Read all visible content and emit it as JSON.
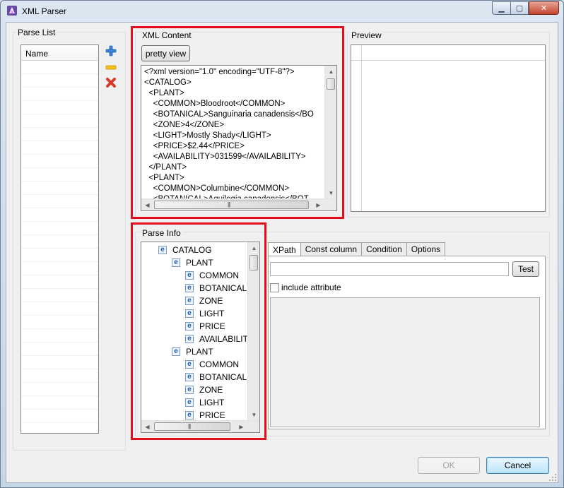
{
  "window": {
    "title": "XML Parser"
  },
  "parse_list": {
    "group_label": "Parse List",
    "column_header": "Name",
    "add_icon": "plus-icon",
    "edit_icon": "minus-icon",
    "delete_icon": "delete-x-icon"
  },
  "xml_content": {
    "group_label": "XML Content",
    "pretty_view_label": "pretty view",
    "lines": [
      "<?xml version=\"1.0\" encoding=\"UTF-8\"?>",
      "<CATALOG>",
      "  <PLANT>",
      "    <COMMON>Bloodroot</COMMON>",
      "    <BOTANICAL>Sanguinaria canadensis</BO",
      "    <ZONE>4</ZONE>",
      "    <LIGHT>Mostly Shady</LIGHT>",
      "    <PRICE>$2.44</PRICE>",
      "    <AVAILABILITY>031599</AVAILABILITY>",
      "  </PLANT>",
      "  <PLANT>",
      "    <COMMON>Columbine</COMMON>",
      "    <BOTANICAL>Aquilegia canadensis</BOT"
    ]
  },
  "preview": {
    "group_label": "Preview"
  },
  "parse_info": {
    "group_label": "Parse Info",
    "tree": [
      {
        "label": "CATALOG",
        "level": 0
      },
      {
        "label": "PLANT",
        "level": 1
      },
      {
        "label": "COMMON",
        "level": 2
      },
      {
        "label": "BOTANICAL",
        "level": 2
      },
      {
        "label": "ZONE",
        "level": 2
      },
      {
        "label": "LIGHT",
        "level": 2
      },
      {
        "label": "PRICE",
        "level": 2
      },
      {
        "label": "AVAILABILITY",
        "level": 2
      },
      {
        "label": "PLANT",
        "level": 1
      },
      {
        "label": "COMMON",
        "level": 2
      },
      {
        "label": "BOTANICAL",
        "level": 2
      },
      {
        "label": "ZONE",
        "level": 2
      },
      {
        "label": "LIGHT",
        "level": 2
      },
      {
        "label": "PRICE",
        "level": 2
      }
    ],
    "element_icon_glyph": "e"
  },
  "tabs": {
    "items": [
      {
        "label": "XPath",
        "active": true
      },
      {
        "label": "Const column",
        "active": false
      },
      {
        "label": "Condition",
        "active": false
      },
      {
        "label": "Options",
        "active": false
      }
    ],
    "xpath_value": "",
    "test_label": "Test",
    "include_attribute_label": "include attribute",
    "include_attribute_checked": false
  },
  "footer": {
    "ok_label": "OK",
    "cancel_label": "Cancel"
  },
  "colors": {
    "highlight_frame": "#e3101b",
    "focus_border": "#3c7fb1"
  }
}
